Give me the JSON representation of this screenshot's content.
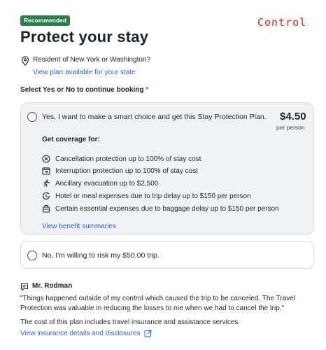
{
  "header": {
    "badge": "Recommended",
    "control_tag": "Control",
    "title": "Protect your stay"
  },
  "residency": {
    "question": "Resident of New York or Washington?",
    "link": "View plan available for your state"
  },
  "select_prompt": "Select Yes or No to continue booking",
  "required_mark": "*",
  "yes_option": {
    "label": "Yes, I want to make a smart choice and get this Stay Protection Plan.",
    "price": "$4.50",
    "price_unit": "per person",
    "coverage_title": "Get coverage for:",
    "benefits": [
      {
        "icon": "cancel-circle-icon",
        "text": "Cancellation protection up to 100% of stay cost"
      },
      {
        "icon": "calendar-interruption-icon",
        "text": "Interruption protection up to 100% of stay cost"
      },
      {
        "icon": "running-person-icon",
        "text": "Ancillary evacuation up to $2,500"
      },
      {
        "icon": "clock-delay-icon",
        "text": "Hotel or meal expenses due to trip delay up to $150 per person"
      },
      {
        "icon": "baggage-icon",
        "text": "Certain essential expenses due to baggage delay up to $150 per person"
      }
    ],
    "summaries_link": "View benefit summaries"
  },
  "no_option": {
    "label": "No, I'm willing to risk my $50.00 trip."
  },
  "review": {
    "author": "Mr. Rodman",
    "quote": "\"Things happened outside of my control which caused the trip to be canceled. The Travel Protection was valuable in reducing the losses to me when we had to cancel the trip.\""
  },
  "footer": {
    "cost_note": "The cost of this plan includes travel insurance and assistance services.",
    "details_link": "View insurance details and disclosures"
  },
  "colors": {
    "badge_bg": "#2f7d4a",
    "link": "#3162d6",
    "required": "#d52a2a",
    "control_tag": "#e02020",
    "card_bg": "#f0f2f5"
  }
}
